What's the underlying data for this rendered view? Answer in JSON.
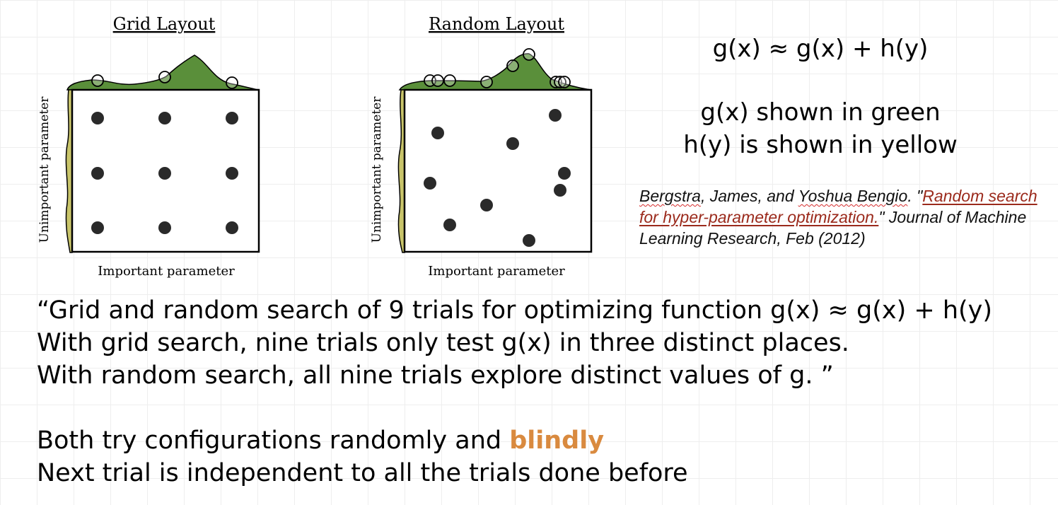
{
  "figures": {
    "grid": {
      "title": "Grid Layout",
      "xlabel": "Important parameter",
      "ylabel": "Unimportant parameter"
    },
    "random": {
      "title": "Random Layout",
      "xlabel": "Important parameter",
      "ylabel": "Unimportant parameter"
    }
  },
  "formula": {
    "main": "g(x) ≈ g(x) + h(y)",
    "note_green": "g(x) shown in green",
    "note_yellow": "h(y) is shown in yellow"
  },
  "citation": {
    "author1": "Bergstra",
    "rest1": ", James, and ",
    "author2": "Yoshua Bengio",
    "rest2": ". \"",
    "link": "Random search for hyper-parameter optimization.",
    "rest3": "\" Journal of Machine Learning Research, Feb (2012)"
  },
  "quote": {
    "line1": "“Grid and random search of 9 trials for optimizing function g(x) ≈ g(x) + h(y)",
    "line2": "With grid search, nine trials only test g(x) in three distinct places.",
    "line3": "With random search, all nine trials explore distinct values of g. ”"
  },
  "bottom": {
    "line1_prefix": "Both try configurations randomly and ",
    "line1_highlight": "blindly",
    "line2": "Next trial is independent to all the trials done before"
  },
  "colors": {
    "green_fill": "#5a8f3a",
    "yellow_fill": "#c8c46a",
    "highlight": "#d98a3f",
    "citation_link": "#9b2a1c"
  }
}
